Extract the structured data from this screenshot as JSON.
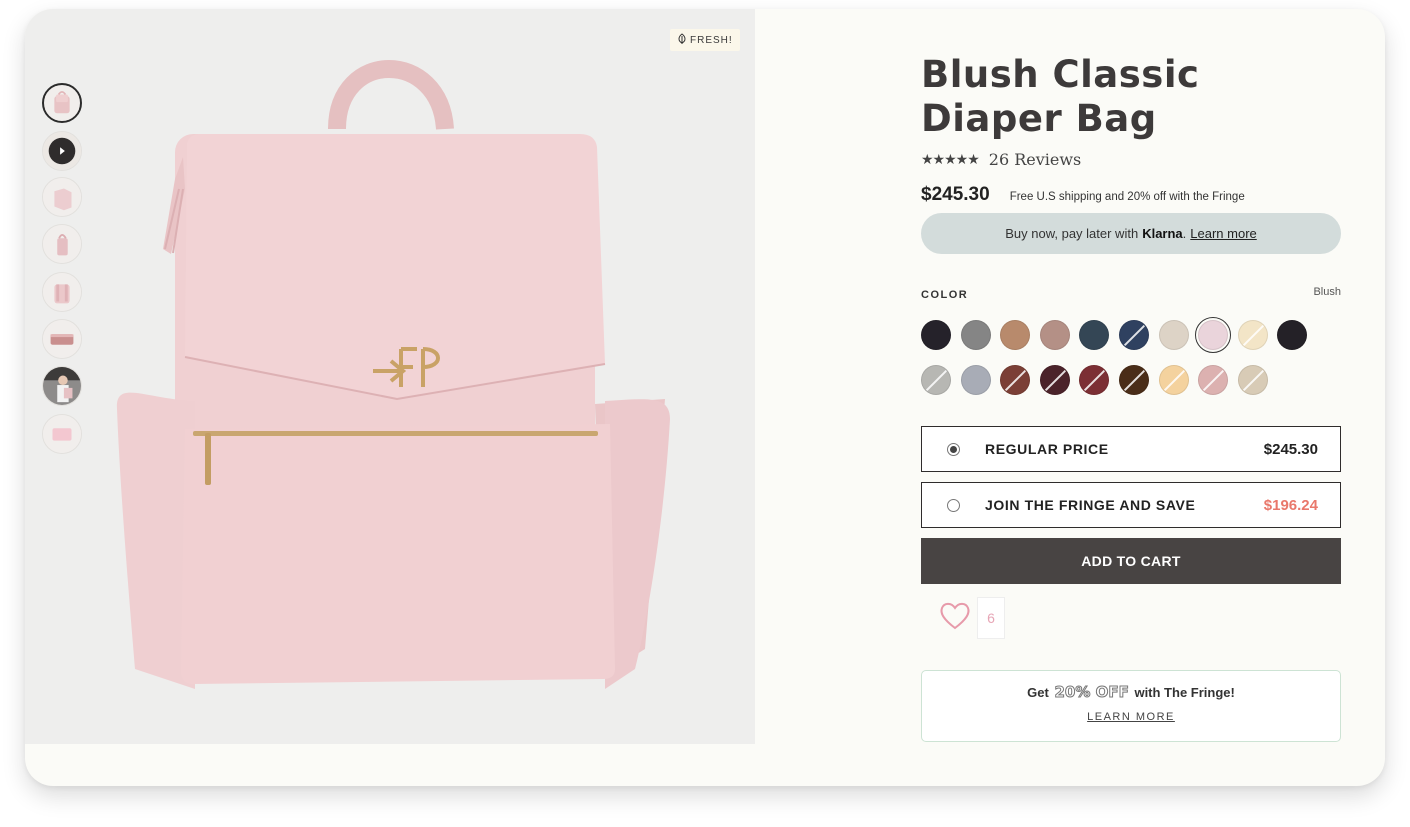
{
  "product": {
    "title": "Blush Classic Diaper Bag",
    "stars": "★★★★★",
    "reviews": "26 Reviews",
    "price": "$245.30",
    "shipping_note": "Free U.S shipping and 20% off with the Fringe"
  },
  "klarna": {
    "prefix": "Buy now, pay later with",
    "brand": "Klarna",
    "period": ".",
    "link": "Learn more"
  },
  "badge": {
    "label": "FRESH!",
    "icon": "leaf-icon"
  },
  "gallery": {
    "thumbnails": [
      {
        "kind": "bag-front",
        "active": true
      },
      {
        "kind": "video-play",
        "active": false
      },
      {
        "kind": "bag-angle",
        "active": false
      },
      {
        "kind": "bag-side",
        "active": false
      },
      {
        "kind": "bag-back",
        "active": false
      },
      {
        "kind": "bag-bottom",
        "active": false
      },
      {
        "kind": "lifestyle",
        "active": false
      },
      {
        "kind": "pouch",
        "active": false
      }
    ]
  },
  "color": {
    "label": "COLOR",
    "selected": "Blush",
    "swatches": [
      {
        "color": "#25222a"
      },
      {
        "color": "#858585"
      },
      {
        "color": "#b88a6c"
      },
      {
        "color": "#b49086"
      },
      {
        "color": "#344655"
      },
      {
        "color": "#2f4160",
        "slash": true
      },
      {
        "color": "#ddd3c6"
      },
      {
        "color": "#ead4db",
        "selected": true
      },
      {
        "color": "#f3e5c7",
        "slash": true
      },
      {
        "color": "#242127"
      },
      {
        "color": "#b7b7b3",
        "slash": true
      },
      {
        "color": "#a8acb6"
      },
      {
        "color": "#7b3f36",
        "slash": true
      },
      {
        "color": "#4b232a",
        "slash": true
      },
      {
        "color": "#7c2f34",
        "slash": true
      },
      {
        "color": "#4a2d18",
        "slash": true
      },
      {
        "color": "#f4d29e",
        "slash": true
      },
      {
        "color": "#dcb1b0",
        "slash": true
      },
      {
        "color": "#d8cbb6",
        "slash": true
      }
    ]
  },
  "options": [
    {
      "label": "REGULAR PRICE",
      "price": "$245.30",
      "checked": true
    },
    {
      "label": "JOIN THE FRINGE AND SAVE",
      "price": "$196.24",
      "checked": false
    }
  ],
  "cart": {
    "label": "ADD TO CART"
  },
  "wishlist": {
    "count": "6",
    "icon": "heart-icon"
  },
  "promo": {
    "prefix": "Get",
    "highlight": "20% OFF",
    "suffix": "with The Fringe!",
    "link": "LEARN MORE"
  }
}
